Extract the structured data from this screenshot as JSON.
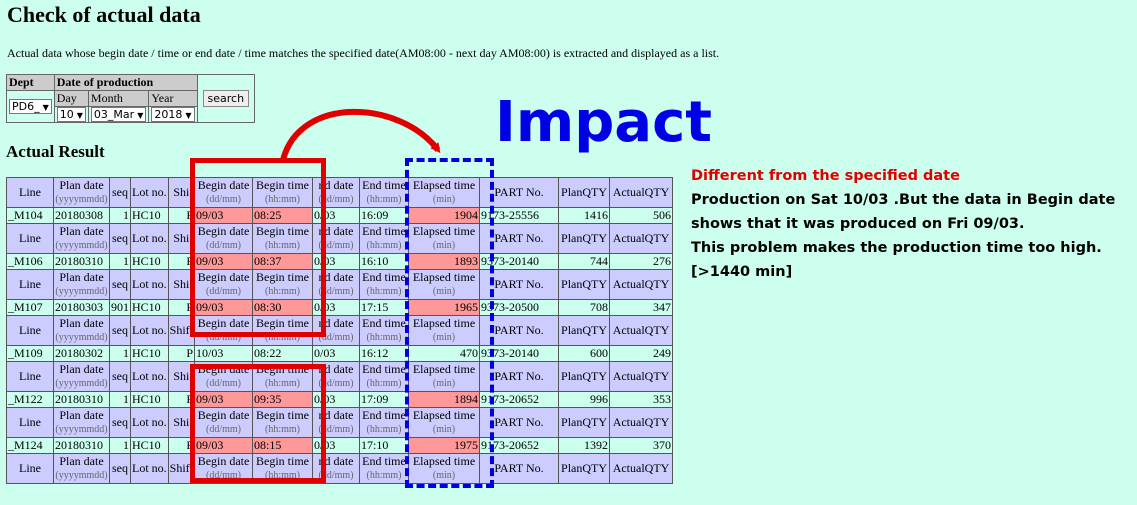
{
  "page": {
    "title": "Check of actual data",
    "intro": "Actual data whose begin date / time or end date / time matches the specified date(AM08:00 - next day AM08:00) is extracted and displayed as a list."
  },
  "search": {
    "dept_header": "Dept",
    "dop_header": "Date of production",
    "day_label": "Day",
    "month_label": "Month",
    "year_label": "Year",
    "dept_value": "PD6_",
    "day_value": "10",
    "month_value": "03_Mar",
    "year_value": "2018",
    "search_label": "search"
  },
  "results": {
    "title": "Actual Result",
    "headers": {
      "line": "Line",
      "plan_date": "Plan date",
      "plan_date_unit": "(yyyymmdd)",
      "seq": "seq",
      "lot": "Lot no.",
      "shift": "Shift",
      "shift_trunc": "Shi",
      "begin_date": "Begin date",
      "begin_date_unit": "(dd/mm)",
      "begin_time": "Begin time",
      "begin_time_unit": "(hh:mm)",
      "end_date": "nd date",
      "end_date_unit": "(dd/mm)",
      "end_time": "End time",
      "end_time_unit": "(hh:mm)",
      "elapsed": "Elapsed time",
      "elapsed_unit": "(min)",
      "part": "PART No.",
      "plan_qty": "PlanQTY",
      "actual_qty": "ActualQTY"
    },
    "rows": [
      {
        "line": "_M104",
        "plan_date": "20180308",
        "seq": "1",
        "lot": "HC10",
        "shift": "P",
        "begin_date": "09/03",
        "begin_time": "08:25",
        "end_date": "0/03",
        "end_time": "16:09",
        "elapsed": "1904",
        "part": "9173-25556",
        "plan_qty": "1416",
        "actual_qty": "506"
      },
      {
        "line": "_M106",
        "plan_date": "20180310",
        "seq": "1",
        "lot": "HC10",
        "shift": "P",
        "begin_date": "09/03",
        "begin_time": "08:37",
        "end_date": "0/03",
        "end_time": "16:10",
        "elapsed": "1893",
        "part": "9373-20140",
        "plan_qty": "744",
        "actual_qty": "276"
      },
      {
        "line": "_M107",
        "plan_date": "20180303",
        "seq": "901",
        "lot": "HC10",
        "shift": "P",
        "begin_date": "09/03",
        "begin_time": "08:30",
        "end_date": "0/03",
        "end_time": "17:15",
        "elapsed": "1965",
        "part": "9373-20500",
        "plan_qty": "708",
        "actual_qty": "347"
      },
      {
        "line": "_M109",
        "plan_date": "20180302",
        "seq": "1",
        "lot": "HC10",
        "shift": "P",
        "begin_date": "10/03",
        "begin_time": "08:22",
        "end_date": "0/03",
        "end_time": "16:12",
        "elapsed": "470",
        "part": "9373-20140",
        "plan_qty": "600",
        "actual_qty": "249"
      },
      {
        "line": "_M122",
        "plan_date": "20180310",
        "seq": "1",
        "lot": "HC10",
        "shift": "P",
        "begin_date": "09/03",
        "begin_time": "09:35",
        "end_date": "0/03",
        "end_time": "17:09",
        "elapsed": "1894",
        "part": "9173-20652",
        "plan_qty": "996",
        "actual_qty": "353"
      },
      {
        "line": "_M124",
        "plan_date": "20180310",
        "seq": "1",
        "lot": "HC10",
        "shift": "P",
        "begin_date": "09/03",
        "begin_time": "08:15",
        "end_date": "0/03",
        "end_time": "17:10",
        "elapsed": "1975",
        "part": "9173-20652",
        "plan_qty": "1392",
        "actual_qty": "370"
      }
    ]
  },
  "annotation": {
    "impact": "Impact",
    "heading": "Different from the specified date",
    "line1_a": "Production on Sat ",
    "line1_b": "10/03",
    "line1_c": " .But the data in Begin date",
    "line2": "shows that it was produced on Fri 09/03.",
    "line3": "This problem makes the production time too high.",
    "line4": "[>1440 min]"
  },
  "colors": {
    "background": "#ccffee",
    "header_cell": "#ccccff",
    "highlight_cell": "#ff9999",
    "mark_red": "#e00000",
    "mark_blue": "#0000e6"
  }
}
